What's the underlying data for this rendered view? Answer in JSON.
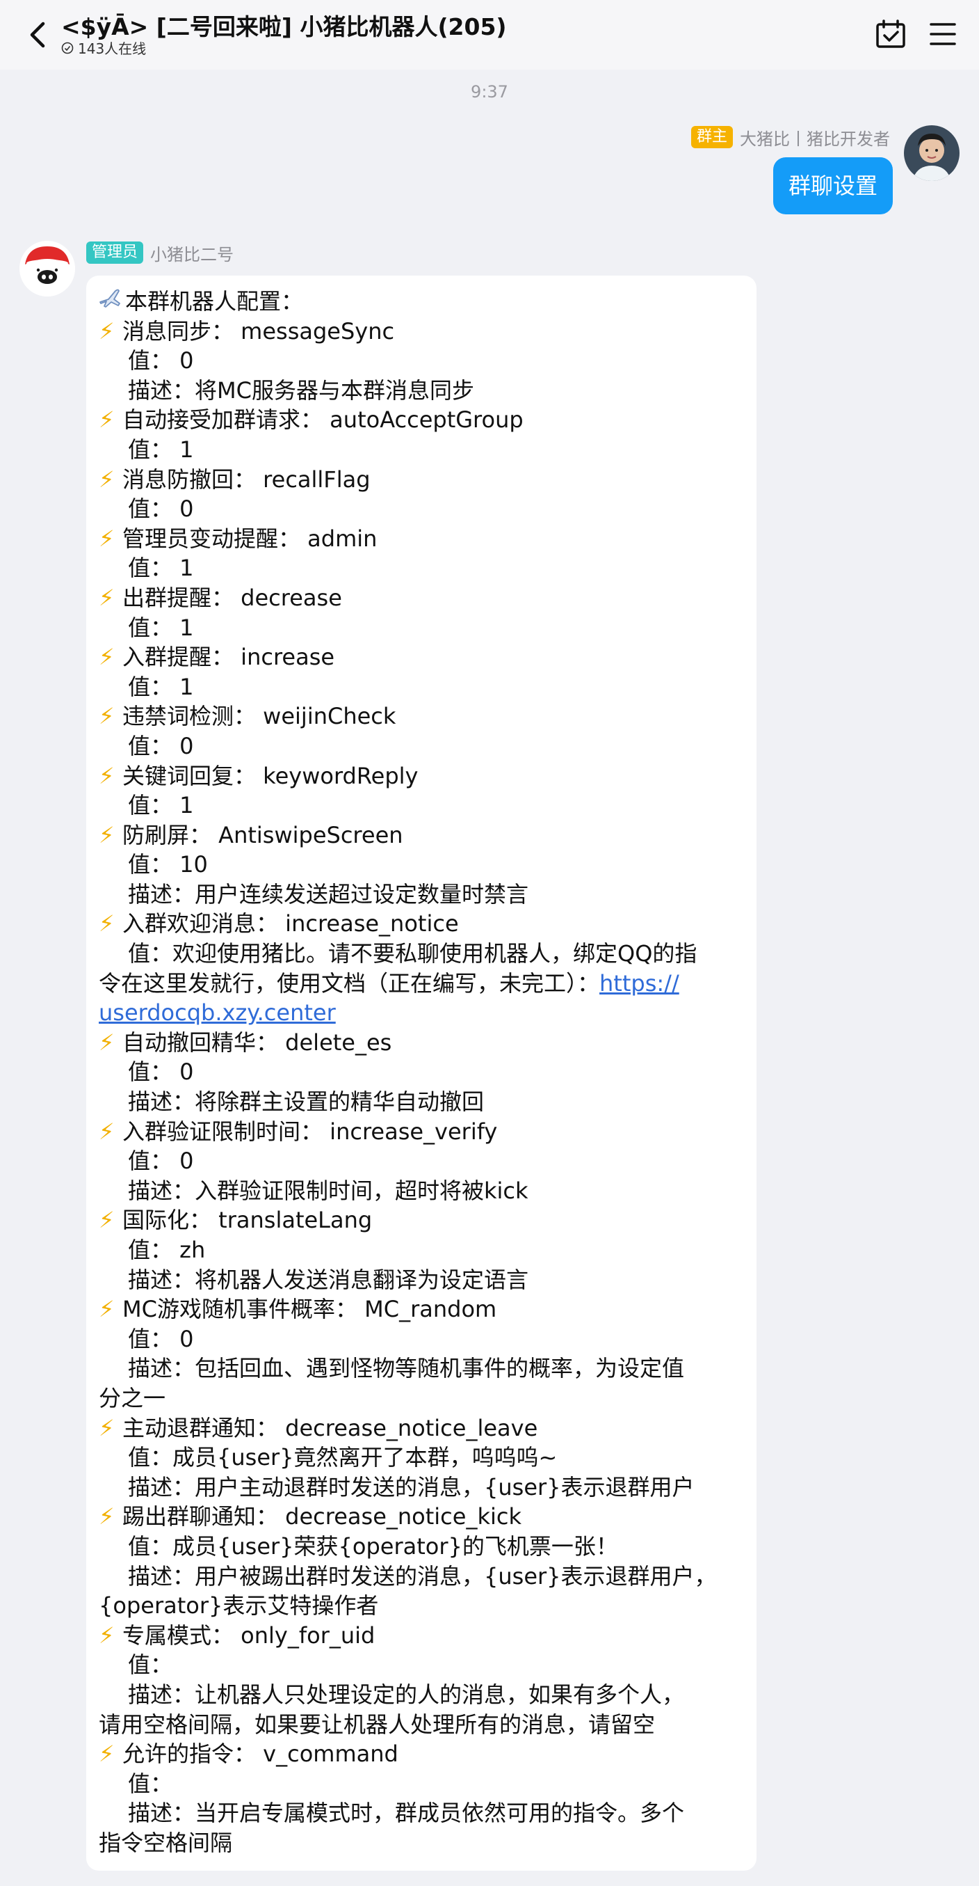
{
  "header": {
    "title": "<$ÿĀ> [二号回来啦] 小猪比机器人(205)",
    "online": "143人在线"
  },
  "timestamp": "9:37",
  "owner_message": {
    "badge": "群主",
    "sender": "大猪比丨猪比开发者",
    "text": "群聊设置"
  },
  "bot_message": {
    "badge": "管理员",
    "sender": "小猪比二号",
    "lines": {
      "l1": "本群机器人配置：",
      "l2": "消息同步：  messageSync",
      "l3": "值：  0",
      "l4": "描述：将MC服务器与本群消息同步",
      "l5": "自动接受加群请求：  autoAcceptGroup",
      "l6": "值：  1",
      "l7": "消息防撤回：  recallFlag",
      "l8": "值：  0",
      "l9": "管理员变动提醒：  admin",
      "l10": "值：  1",
      "l11": "出群提醒：  decrease",
      "l12": "值：  1",
      "l13": "入群提醒：  increase",
      "l14": "值：  1",
      "l15": "违禁词检测：  weijinCheck",
      "l16": "值：  0",
      "l17": "关键词回复：  keywordReply",
      "l18": "值：  1",
      "l19": "防刷屏：  AntiswipeScreen",
      "l20": "值：  10",
      "l21": "描述：用户连续发送超过设定数量时禁言",
      "l22": "入群欢迎消息：  increase_notice",
      "l23": "值：欢迎使用猪比。请不要私聊使用机器人，绑定QQ的指",
      "l24a": "令在这里发就行，使用文档（正在编写，未完工）：",
      "l24b": "https://",
      "l25": "userdocqb.xzy.center",
      "l26": "自动撤回精华：  delete_es",
      "l27": "值：  0",
      "l28": "描述：将除群主设置的精华自动撤回",
      "l29": "入群验证限制时间：  increase_verify",
      "l30": "值：  0",
      "l31": "描述：入群验证限制时间，超时将被kick",
      "l32": "国际化：  translateLang",
      "l33": "值：  zh",
      "l34": "描述：将机器人发送消息翻译为设定语言",
      "l35": "MC游戏随机事件概率：  MC_random",
      "l36": "值：  0",
      "l37": "描述：包括回血、遇到怪物等随机事件的概率，为设定值",
      "l38": "分之一",
      "l39": "主动退群通知：  decrease_notice_leave",
      "l40": "值：成员{user}竟然离开了本群，呜呜呜~",
      "l41": "描述：用户主动退群时发送的消息，{user}表示退群用户",
      "l42": "踢出群聊通知：  decrease_notice_kick",
      "l43": "值：成员{user}荣获{operator}的飞机票一张！",
      "l44": "描述：用户被踢出群时发送的消息，{user}表示退群用户，",
      "l45": "{operator}表示艾特操作者",
      "l46": "专属模式：  only_for_uid",
      "l47": "值：",
      "l48": "描述：让机器人只处理设定的人的消息，如果有多个人，",
      "l49": "请用空格间隔，如果要让机器人处理所有的消息，请留空",
      "l50": "允许的指令：  v_command",
      "l51": "值：",
      "l52": "描述：当开启专属模式时，群成员依然可用的指令。多个",
      "l53": "指令空格间隔"
    }
  },
  "icons": {
    "back": "chevron-left-icon",
    "online": "clock-icon",
    "calendar": "calendar-check-icon",
    "menu": "hamburger-menu-icon",
    "bolt": "lightning-bolt-icon",
    "plane": "airplane-icon"
  },
  "colors": {
    "owner_badge": "#f6b200",
    "admin_badge": "#34c6c3",
    "self_bubble": "#149cf8",
    "link": "#2f6bd8"
  }
}
